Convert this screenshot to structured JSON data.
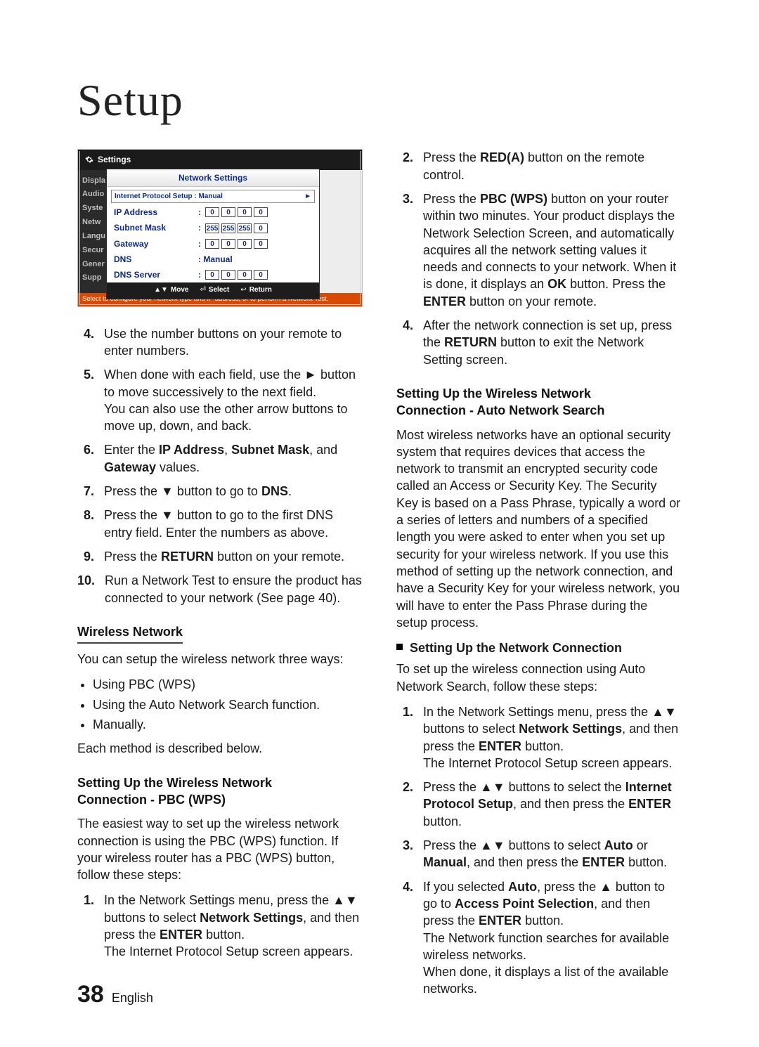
{
  "title": "Setup",
  "footer": {
    "page": "38",
    "lang": "English"
  },
  "osd": {
    "header": "Settings",
    "ns_title": "Network Settings",
    "left": [
      "Displa",
      "Audio",
      "Syste",
      "Netw",
      "Langu",
      "Secur",
      "Gener",
      "Supp"
    ],
    "ip_setup_label": "Internet Protocol Setup  : Manual",
    "rows": {
      "ip": {
        "label": "IP Address",
        "v": [
          "0",
          "0",
          "0",
          "0"
        ]
      },
      "mask": {
        "label": "Subnet Mask",
        "v": [
          "255",
          "255",
          "255",
          "0"
        ]
      },
      "gw": {
        "label": "Gateway",
        "v": [
          "0",
          "0",
          "0",
          "0"
        ]
      },
      "dns": {
        "label": "DNS",
        "value": ": Manual"
      },
      "dnssrv": {
        "label": "DNS Server",
        "v": [
          "0",
          "0",
          "0",
          "0"
        ]
      }
    },
    "soft": {
      "move": "Move",
      "select": "Select",
      "return": "Return"
    },
    "help": "Select to configure your network type and IP address, or to perform a Network Test."
  },
  "left": {
    "steps_a": [
      {
        "n": "4.",
        "t": "Use the number buttons on your remote to enter numbers."
      },
      {
        "n": "5.",
        "t": "When done with each field, use the ► button to move successively to the next field.\nYou can also use the other arrow buttons to move up, down, and back."
      },
      {
        "n": "6.",
        "pre": "Enter the ",
        "b1": "IP Address",
        "mid1": ", ",
        "b2": "Subnet Mask",
        "mid2": ", and ",
        "b3": "Gateway",
        "post": " values."
      },
      {
        "n": "7.",
        "pre": "Press the ▼ button to go to ",
        "b1": "DNS",
        "post": "."
      },
      {
        "n": "8.",
        "t": "Press the ▼ button to go to the first DNS entry field. Enter the numbers as above."
      },
      {
        "n": "9.",
        "pre": "Press the ",
        "b1": "RETURN",
        "post": " button on your remote."
      },
      {
        "n": "10.",
        "t": "Run a Network Test to ensure the product has connected to your network (See page 40)."
      }
    ],
    "wireless_h": "Wireless Network",
    "wireless_intro": "You can setup the wireless network three ways:",
    "wireless_ways": [
      "Using PBC (WPS)",
      "Using the Auto Network Search function.",
      "Manually."
    ],
    "wireless_note": "Each method is described below.",
    "pbc_h": "Setting Up the Wireless Network\nConnection - PBC (WPS)",
    "pbc_intro": "The easiest way to set up the wireless network connection is using the PBC (WPS) function. If your wireless router has a PBC (WPS) button, follow these steps:",
    "pbc_step1": {
      "n": "1.",
      "pre": "In the Network Settings menu, press the ▲▼ buttons to select ",
      "b1": "Network Settings",
      "mid1": ", and then press the ",
      "b2": "ENTER",
      "post": " button.\nThe Internet Protocol Setup screen appears."
    }
  },
  "right": {
    "steps_top": [
      {
        "n": "2.",
        "pre": "Press the ",
        "b1": "RED(A)",
        "post": " button on the remote control."
      },
      {
        "n": "3.",
        "pre": "Press the ",
        "b1": "PBC (WPS)",
        "mid1": " button on your router within two minutes. Your product displays the Network Selection Screen, and automatically acquires all the network setting values it needs and connects to your network. When it is done, it displays an ",
        "b2": "OK",
        "mid2": " button. Press the ",
        "b3": "ENTER",
        "post": " button on your remote."
      },
      {
        "n": "4.",
        "pre": "After the network connection is set up, press the ",
        "b1": "RETURN",
        "post": " button to exit the Network Setting screen."
      }
    ],
    "auto_h": "Setting Up the Wireless Network\nConnection - Auto Network Search",
    "auto_p": "Most wireless networks have an optional security system that requires devices that access the network to transmit an encrypted security code called an Access or Security Key. The Security Key is based on a Pass Phrase, typically a word or a series of letters and numbers of a specified length you were asked to enter when you set up security for your wireless network. If you use this method of setting up the network connection, and have a Security Key for your wireless network, you will have to enter the Pass Phrase during the setup process.",
    "auto_sub": "Setting Up the Network Connection",
    "auto_sub_p": "To set up the wireless connection using Auto Network Search, follow these steps:",
    "auto_steps": [
      {
        "n": "1.",
        "pre": "In the Network Settings menu, press the ▲▼ buttons to select ",
        "b1": "Network Settings",
        "mid1": ", and then press the ",
        "b2": "ENTER",
        "post": " button.\nThe Internet Protocol Setup screen appears."
      },
      {
        "n": "2.",
        "pre": "Press the ▲▼ buttons to select the ",
        "b1": "Internet Protocol Setup",
        "mid1": ", and then press the ",
        "b2": "ENTER",
        "post": " button."
      },
      {
        "n": "3.",
        "pre": "Press the ▲▼ buttons to select ",
        "b1": "Auto",
        "mid1": " or ",
        "b2": "Manual",
        "mid2": ", and then press the ",
        "b3": "ENTER",
        "post": " button."
      },
      {
        "n": "4.",
        "pre": "If you selected ",
        "b1": "Auto",
        "mid1": ", press the ▲ button to go to ",
        "b2": "Access Point Selection",
        "mid2": ", and then press the ",
        "b3": "ENTER",
        "post": " button.\nThe Network function searches for available wireless networks.\nWhen done, it displays a list of the available networks."
      }
    ]
  }
}
